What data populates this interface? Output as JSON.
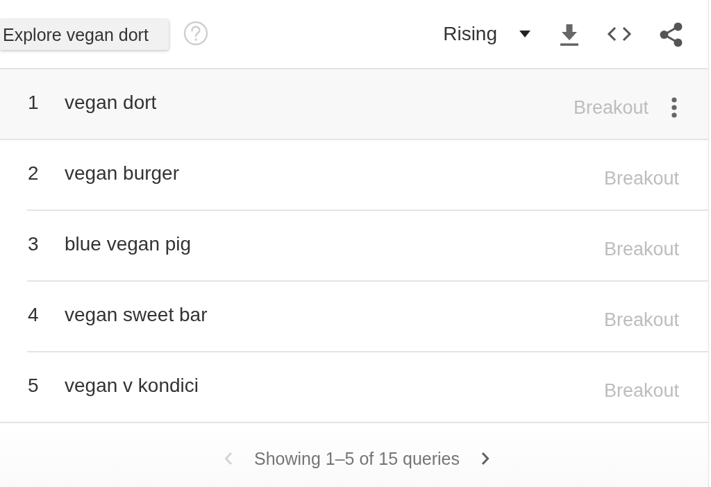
{
  "header": {
    "tooltip": "Explore vegan dort",
    "filter": {
      "value": "Rising"
    }
  },
  "rows": [
    {
      "rank": "1",
      "query": "vegan dort",
      "value": "Breakout",
      "hovered": true
    },
    {
      "rank": "2",
      "query": "vegan burger",
      "value": "Breakout",
      "hovered": false
    },
    {
      "rank": "3",
      "query": "blue vegan pig",
      "value": "Breakout",
      "hovered": false
    },
    {
      "rank": "4",
      "query": "vegan sweet bar",
      "value": "Breakout",
      "hovered": false
    },
    {
      "rank": "5",
      "query": "vegan v kondici",
      "value": "Breakout",
      "hovered": false
    }
  ],
  "pagination": {
    "summary": "Showing 1–5 of 15 queries",
    "previous": {
      "disabled": true
    },
    "next": {
      "disabled": false
    }
  }
}
